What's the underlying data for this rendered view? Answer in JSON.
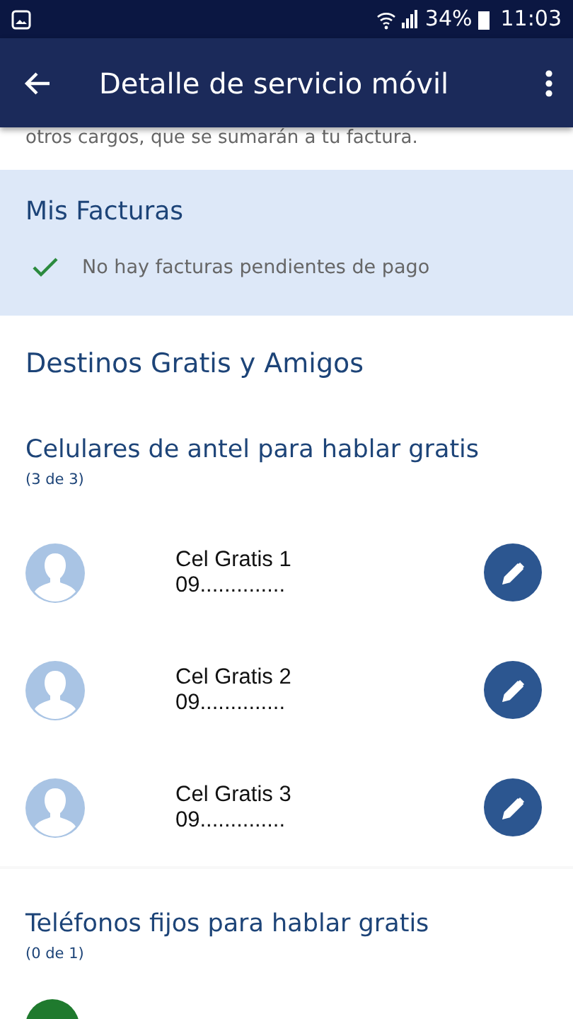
{
  "status_bar": {
    "battery": "34%",
    "time": "11:03"
  },
  "app_bar": {
    "title": "Detalle de servicio móvil"
  },
  "intro_text": "otros cargos, que se sumarán a tu factura.",
  "invoices": {
    "title": "Mis Facturas",
    "message": "No hay facturas pendientes de pago"
  },
  "free_destinations": {
    "title": "Destinos Gratis y Amigos",
    "groups": [
      {
        "title": "Celulares de antel para hablar gratis",
        "count": "(3 de 3)",
        "contacts": [
          {
            "name": "Cel Gratis 1",
            "number": "09.............."
          },
          {
            "name": "Cel Gratis 2",
            "number": "09.............."
          },
          {
            "name": "Cel Gratis 3",
            "number": "09.............."
          }
        ]
      },
      {
        "title": "Teléfonos fijos para hablar gratis",
        "count": "(0 de 1)"
      }
    ]
  }
}
